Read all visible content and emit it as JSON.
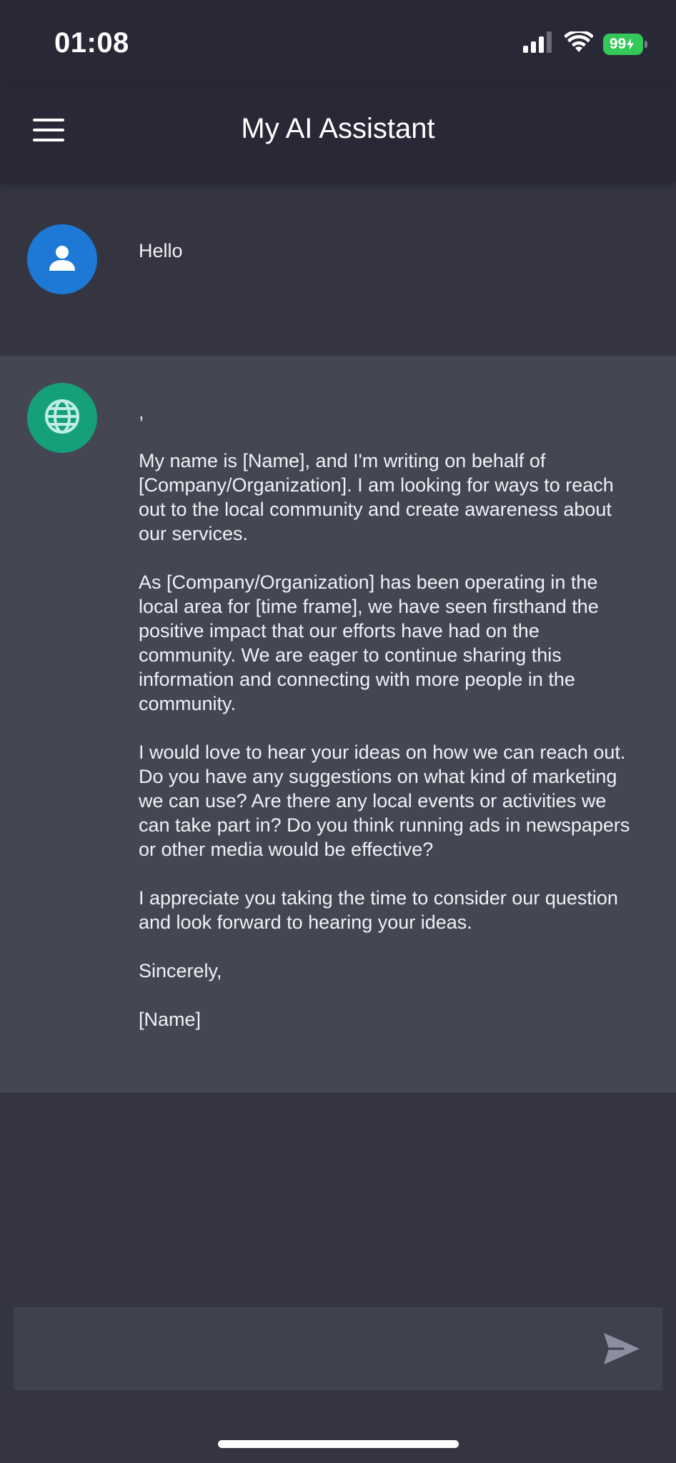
{
  "status_bar": {
    "time": "01:08",
    "battery": "99",
    "icons": [
      "cellular-signal-icon",
      "wifi-icon",
      "battery-charging-icon"
    ]
  },
  "header": {
    "title": "My AI Assistant",
    "menu_icon": "hamburger-menu-icon"
  },
  "conversation": {
    "user_message": {
      "avatar_icon": "person-icon",
      "text": "Hello"
    },
    "assistant_message": {
      "avatar_icon": "globe-icon",
      "paragraphs": [
        ",",
        "My name is [Name], and I'm writing on behalf of [Company/Organization]. I am looking for ways to reach out to the local community and create awareness about our services.",
        "As [Company/Organization] has been operating in the local area for [time frame], we have seen firsthand the positive impact that our efforts have had on the community. We are eager to continue sharing this information and connecting with more people in the community.",
        "I would love to hear your ideas on how we can reach out. Do you have any suggestions on what kind of marketing we can use? Are there any local events or activities we can take part in? Do you think running ads in newspapers or other media would be effective?",
        "I appreciate you taking the time to consider our question and look forward to hearing your ideas.",
        "Sincerely,",
        "[Name]"
      ]
    }
  },
  "composer": {
    "value": "",
    "placeholder": "",
    "send_icon": "send-icon"
  },
  "colors": {
    "background": "#343541",
    "header_background": "#282837",
    "assistant_row": "#444654",
    "composer": "#40414f",
    "user_avatar": "#1e78d6",
    "assistant_avatar": "#16a07a",
    "battery": "#34c759"
  }
}
